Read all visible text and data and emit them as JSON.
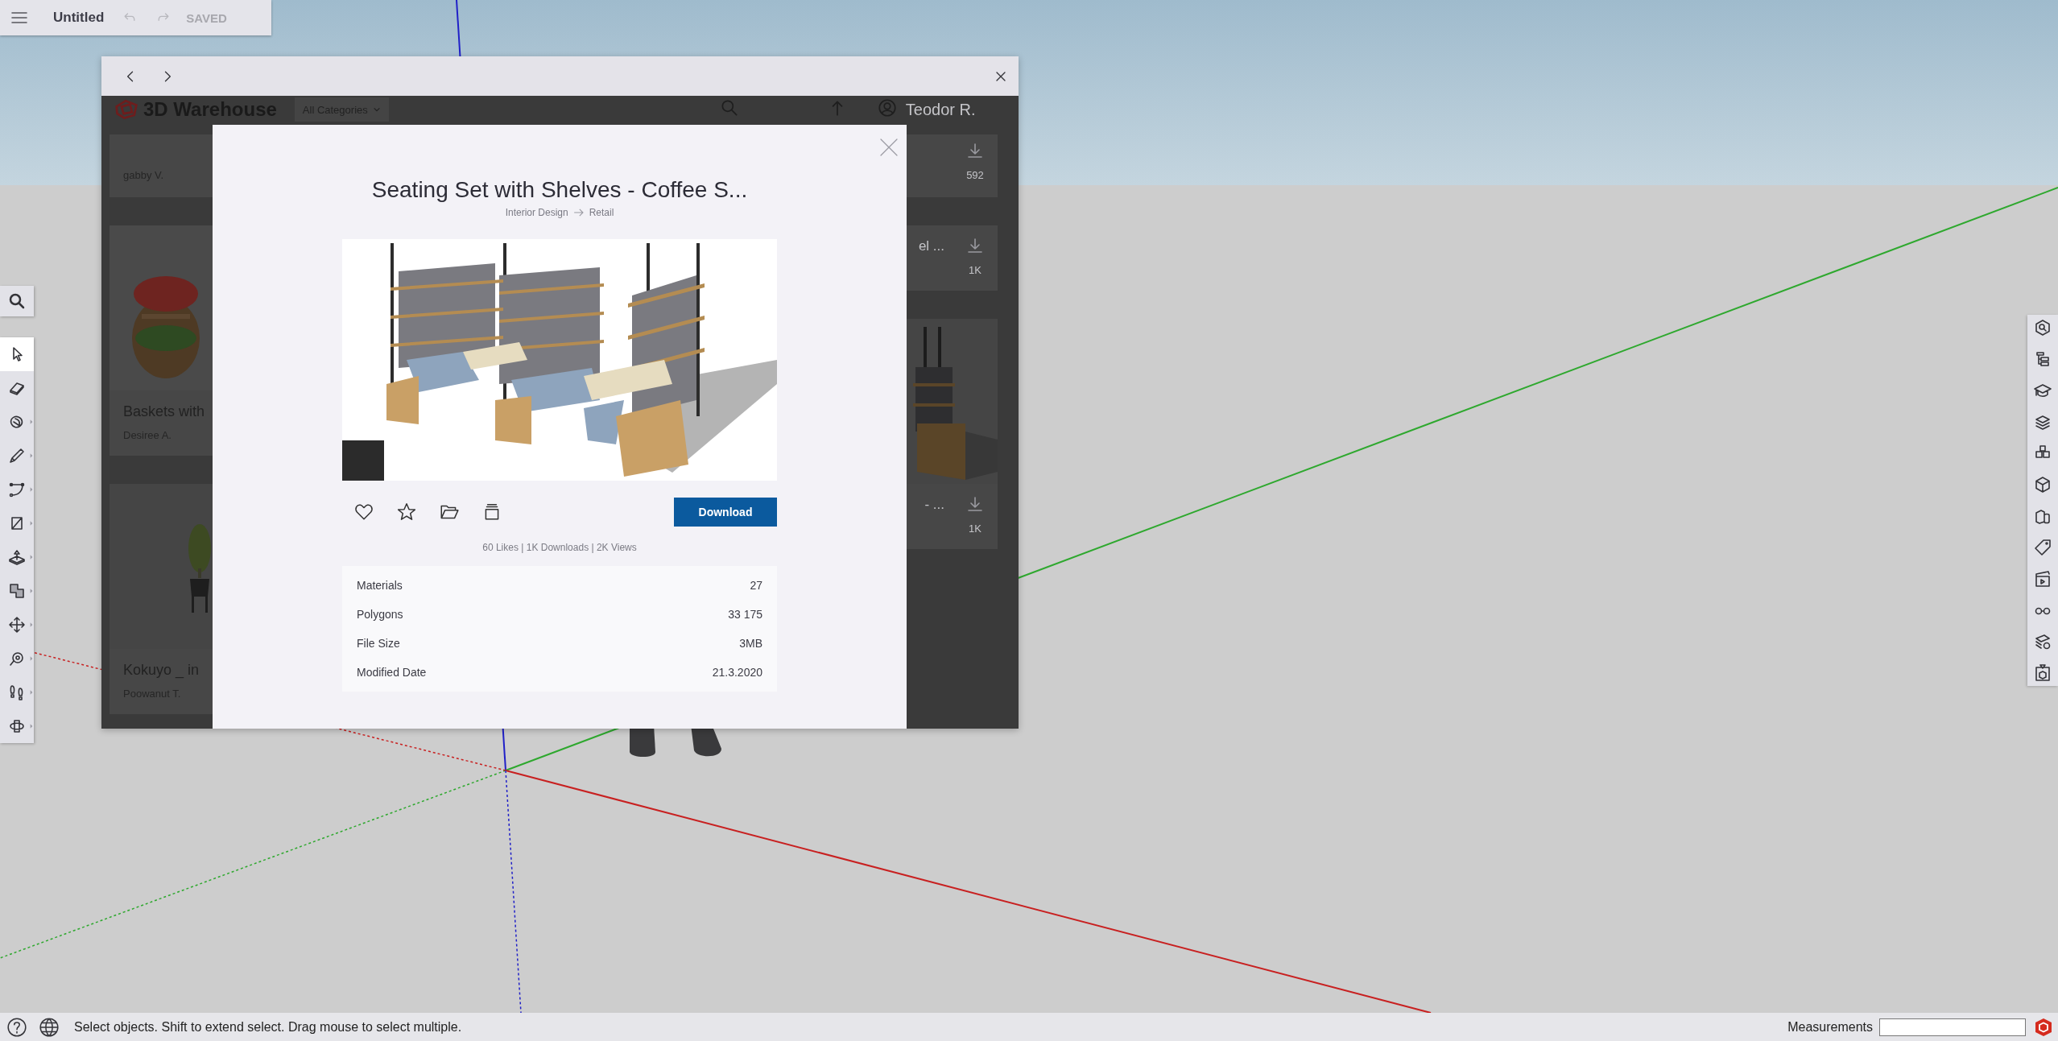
{
  "toolbar": {
    "title": "Untitled",
    "status": "SAVED",
    "history": [
      {
        "kind": "undo",
        "disabled": true
      },
      {
        "kind": "redo",
        "disabled": true
      }
    ]
  },
  "warehouse": {
    "brand": "3D Warehouse",
    "category": "All Categories",
    "user": "Teodor R.",
    "left_cards": [
      {
        "author": "gabby V."
      },
      {
        "title": "Baskets with",
        "author": "Desiree A.",
        "image": {
          "kind": "picture"
        }
      },
      {
        "title": "Kokuyo _ in",
        "author": "Poowanut T.",
        "image": {
          "kind": "picture"
        }
      }
    ],
    "right_cards": [
      {
        "count": "592"
      },
      {
        "title": "el ...",
        "count": "1K"
      },
      {
        "title": "- ...",
        "count": "1K",
        "image": {
          "kind": "picture"
        }
      }
    ]
  },
  "model": {
    "title": "Seating Set with Shelves - Coffee S...",
    "breadcrumb": [
      "Interior Design",
      "Retail"
    ],
    "image": {
      "kind": "picture"
    },
    "download": "Download",
    "stats": "60 Likes | 1K Downloads | 2K Views",
    "details": [
      {
        "label": "Materials",
        "value": "27"
      },
      {
        "label": "Polygons",
        "value": "33 175"
      },
      {
        "label": "File Size",
        "value": "3MB"
      },
      {
        "label": "Modified Date",
        "value": "21.3.2020"
      }
    ]
  },
  "tools": [
    {
      "kind": "select",
      "selected": true,
      "flyout": false
    },
    {
      "kind": "eraser",
      "selected": false,
      "flyout": false
    },
    {
      "kind": "paint",
      "selected": false,
      "flyout": true
    },
    {
      "kind": "pencil",
      "selected": false,
      "flyout": true
    },
    {
      "kind": "arc",
      "selected": false,
      "flyout": true
    },
    {
      "kind": "rectangle",
      "selected": false,
      "flyout": true
    },
    {
      "kind": "pushpull",
      "selected": false,
      "flyout": true
    },
    {
      "kind": "offset",
      "selected": false,
      "flyout": true
    },
    {
      "kind": "move",
      "selected": false,
      "flyout": true
    },
    {
      "kind": "tape",
      "selected": false,
      "flyout": true
    },
    {
      "kind": "walk",
      "selected": false,
      "flyout": true
    },
    {
      "kind": "orbit",
      "selected": false,
      "flyout": true
    }
  ],
  "panels": [
    {
      "kind": "entity"
    },
    {
      "kind": "outliner"
    },
    {
      "kind": "instructor"
    },
    {
      "kind": "layers"
    },
    {
      "kind": "components"
    },
    {
      "kind": "materials"
    },
    {
      "kind": "styles"
    },
    {
      "kind": "tags"
    },
    {
      "kind": "scenes"
    },
    {
      "kind": "display"
    },
    {
      "kind": "info"
    },
    {
      "kind": "export"
    }
  ],
  "status_bar": {
    "hint": "Select objects. Shift to extend select. Drag mouse to select multiple.",
    "measurements_label": "Measurements"
  }
}
